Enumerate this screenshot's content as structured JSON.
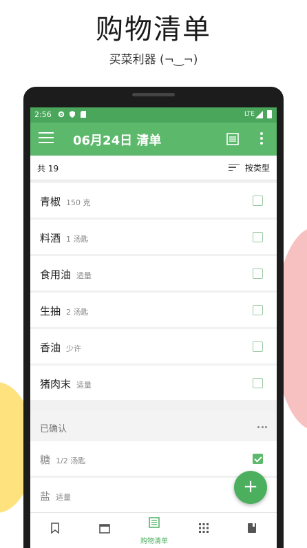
{
  "headline": "购物清单",
  "subline": "买菜利器 (¬‿¬)",
  "status_bar": {
    "time": "2:56",
    "network": "LTE"
  },
  "app_bar": {
    "title": "06月24日 清单"
  },
  "summary": {
    "count": "共 19",
    "sort_label": "按类型"
  },
  "items": [
    {
      "name": "青椒",
      "qty": "150 克"
    },
    {
      "name": "料酒",
      "qty": "1 汤匙"
    },
    {
      "name": "食用油",
      "qty": "适量"
    },
    {
      "name": "生抽",
      "qty": "2 汤匙"
    },
    {
      "name": "香油",
      "qty": "少许"
    },
    {
      "name": "猪肉末",
      "qty": "适量"
    }
  ],
  "confirmed_section": {
    "label": "已确认"
  },
  "confirmed_items": [
    {
      "name": "糖",
      "qty": "1/2 汤匙",
      "checked": true
    },
    {
      "name": "盐",
      "qty": "适量",
      "checked": false
    }
  ],
  "fab": {
    "symbol": "+"
  },
  "bottom_nav": [
    {
      "icon": "bookmark-icon",
      "label": ""
    },
    {
      "icon": "calendar-icon",
      "label": ""
    },
    {
      "icon": "list-icon",
      "label": "购物清单",
      "active": true
    },
    {
      "icon": "grid-icon",
      "label": ""
    },
    {
      "icon": "book-icon",
      "label": ""
    }
  ],
  "colors": {
    "primary": "#5cb86b",
    "status": "#4aa65b",
    "accent": "#4caf5e"
  }
}
